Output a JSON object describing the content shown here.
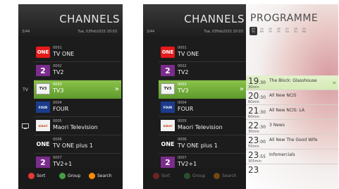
{
  "screen1": {
    "title": "CHANNELS",
    "count": "3/44",
    "date": "Tue, 03Feb2015 20:03",
    "side_label": "TV",
    "channels": [
      {
        "num": "0001",
        "name": "TV ONE",
        "logo": "ONE"
      },
      {
        "num": "0002",
        "name": "TV2",
        "logo": "2"
      },
      {
        "num": "0003",
        "name": "TV3",
        "logo": "TV3"
      },
      {
        "num": "0004",
        "name": "FOUR",
        "logo": "FOUR"
      },
      {
        "num": "0005",
        "name": "Maori Television",
        "logo": "māori"
      },
      {
        "num": "0006",
        "name": "TV ONE plus 1",
        "logo": "ONE"
      },
      {
        "num": "0007",
        "name": "TV2+1",
        "logo": "2"
      }
    ],
    "selected_index": 2,
    "buttons": [
      {
        "label": "Sort",
        "color": "#e53935"
      },
      {
        "label": "Group",
        "color": "#43a047"
      },
      {
        "label": "Search",
        "color": "#fb8c00"
      }
    ]
  },
  "screen2": {
    "title": "CHANNELS",
    "count": "3/44",
    "date": "Tue, 03Feb2015 20:03",
    "programme_title": "PROGRAMME",
    "days": [
      {
        "day": "03",
        "dow": "TU",
        "active": true
      },
      {
        "day": "04",
        "dow": "WE",
        "active": false
      },
      {
        "day": "05",
        "dow": "TH",
        "active": false
      },
      {
        "day": "06",
        "dow": "FR",
        "active": false
      },
      {
        "day": "07",
        "dow": "SA",
        "active": false
      },
      {
        "day": "08",
        "dow": "SU",
        "active": false
      },
      {
        "day": "09",
        "dow": "MO",
        "active": false
      }
    ],
    "channels": [
      {
        "num": "0001",
        "name": "TV ONE"
      },
      {
        "num": "0002",
        "name": "TV2"
      },
      {
        "num": "0003",
        "name": "TV3"
      },
      {
        "num": "0004",
        "name": "FOUR"
      },
      {
        "num": "0005",
        "name": "Maori Television"
      },
      {
        "num": "0006",
        "name": "TV ONE plus 1"
      },
      {
        "num": "0007",
        "name": "TV2+1"
      }
    ],
    "programmes": [
      {
        "hour": "19",
        "min": ":30",
        "title": "The Block: Glasshouse",
        "dur": "30min"
      },
      {
        "hour": "20",
        "min": ":30",
        "title": "All New NCIS",
        "dur": "60min"
      },
      {
        "hour": "21",
        "min": ":30",
        "title": "All New NCIS: LA",
        "dur": "60min"
      },
      {
        "hour": "22",
        "min": ":30",
        "title": "3 News",
        "dur": "30min"
      },
      {
        "hour": "23",
        "min": ":00",
        "title": "All New The Good Wife",
        "dur": "55min"
      },
      {
        "hour": "23",
        "min": ":55",
        "title": "Infomercials",
        "dur": "305min"
      },
      {
        "hour": "23",
        "min": "",
        "title": "",
        "dur": ""
      }
    ],
    "buttons": [
      {
        "label": "Sort",
        "color": "#e53935"
      },
      {
        "label": "Group",
        "color": "#43a047"
      },
      {
        "label": "Search",
        "color": "#fb8c00"
      }
    ]
  }
}
